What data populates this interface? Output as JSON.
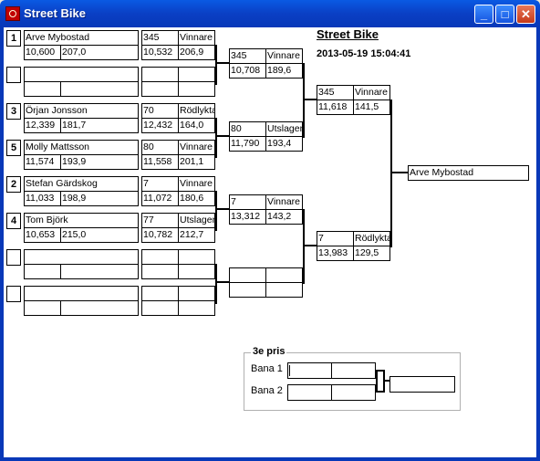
{
  "window": {
    "title": "Street Bike"
  },
  "header": {
    "title": "Street Bike",
    "datetime": "2013-05-19 15:04:41"
  },
  "seeds": {
    "s1": "1",
    "s3": "3",
    "s5": "5",
    "s2": "2",
    "s4": "4"
  },
  "entrants": {
    "e1": {
      "name": "Arve Mybostad",
      "time": "10,600",
      "speed": "207,0"
    },
    "e2": {
      "name": "Örjan Jonsson",
      "time": "12,339",
      "speed": "181,7"
    },
    "e3": {
      "name": "Molly Mattsson",
      "time": "11,574",
      "speed": "193,9"
    },
    "e4": {
      "name": "Stefan Gärdskog",
      "time": "11,033",
      "speed": "198,9"
    },
    "e5": {
      "name": "Tom Björk",
      "time": "10,653",
      "speed": "215,0"
    }
  },
  "round1": {
    "m1a": {
      "num": "345",
      "result": "Vinnare",
      "time": "10,532",
      "speed": "206,9"
    },
    "m2a": {
      "num": "70",
      "result": "Rödlyktа",
      "time": "12,432",
      "speed": "164,0"
    },
    "m2b": {
      "num": "80",
      "result": "Vinnare",
      "time": "11,558",
      "speed": "201,1"
    },
    "m3a": {
      "num": "7",
      "result": "Vinnare",
      "time": "11,072",
      "speed": "180,6"
    },
    "m3b": {
      "num": "77",
      "result": "Utslagen",
      "time": "10,782",
      "speed": "212,7"
    }
  },
  "round2": {
    "a": {
      "num": "345",
      "result": "Vinnare",
      "time": "10,708",
      "speed": "189,6"
    },
    "b": {
      "num": "80",
      "result": "Utslagen",
      "time": "11,790",
      "speed": "193,4"
    },
    "c": {
      "num": "7",
      "result": "Vinnare",
      "time": "13,312",
      "speed": "143,2"
    }
  },
  "semis": {
    "a": {
      "num": "345",
      "result": "Vinnare",
      "time": "11,618",
      "speed": "141,5"
    },
    "b": {
      "num": "7",
      "result": "Rödlyktа",
      "time": "13,983",
      "speed": "129,5"
    }
  },
  "final": {
    "winner": "Arve Mybostad"
  },
  "third_place": {
    "title": "3e pris",
    "lane1": "Bana 1",
    "lane2": "Bana 2"
  }
}
